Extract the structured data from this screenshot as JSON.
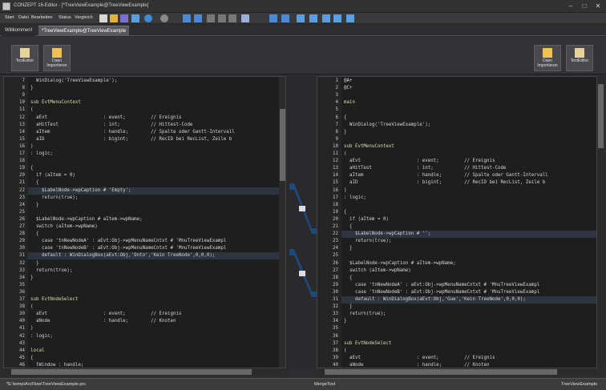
{
  "window": {
    "title": "CONZEPT 16-Editor - [*TreeViewExample@TreeViewExample]"
  },
  "menu": [
    "Start",
    "Datei",
    "Bearbeiten",
    "Status",
    "Vergleich"
  ],
  "tabs": [
    {
      "label": "Willkommen!",
      "active": false
    },
    {
      "label": "*TreeViewExample@TreeViewExample",
      "active": true
    }
  ],
  "ribbon": {
    "left": [
      {
        "label": "TextEditor",
        "icon": "text-editor-icon"
      },
      {
        "label": "Datei Importieren",
        "icon": "folder-import-icon"
      }
    ],
    "right": [
      {
        "label": "Datei Importieren",
        "icon": "folder-import-icon"
      },
      {
        "label": "TextEditor",
        "icon": "text-editor-icon"
      }
    ]
  },
  "left_pane": {
    "lines": [
      {
        "n": "7",
        "t": "  WinDialog('TreeViewExample');"
      },
      {
        "n": "8",
        "t": "}"
      },
      {
        "n": "9",
        "t": ""
      },
      {
        "n": "10",
        "t": "sub EvtMenuContext"
      },
      {
        "n": "11",
        "t": "("
      },
      {
        "n": "12",
        "t": "  aEvt                    : event;         // Ereignis"
      },
      {
        "n": "13",
        "t": "  aHitTest                : int;           // Hittest-Code"
      },
      {
        "n": "14",
        "t": "  aItem                   : handle;        // Spalte oder Gantt-Intervall"
      },
      {
        "n": "15",
        "t": "  aID                     : bigint;        // RecID bei RecList, Zeile b"
      },
      {
        "n": "16",
        "t": ")"
      },
      {
        "n": "17",
        "t": ": logic;"
      },
      {
        "n": "18",
        "t": ""
      },
      {
        "n": "19",
        "t": "{"
      },
      {
        "n": "20",
        "t": "  if (aItem = 0)"
      },
      {
        "n": "21",
        "t": "  {"
      },
      {
        "n": "22",
        "t": "    $LabelNode->wpCaption # 'Empty';"
      },
      {
        "n": "23",
        "t": "    return(true);"
      },
      {
        "n": "24",
        "t": "  }"
      },
      {
        "n": "25",
        "t": ""
      },
      {
        "n": "26",
        "t": "  $LabelNode->wpCaption # aItem->wpName;"
      },
      {
        "n": "27",
        "t": "  switch (aItem->wpName)"
      },
      {
        "n": "28",
        "t": "  {"
      },
      {
        "n": "29",
        "t": "    case 'tnNewNodeA' : aEvt:Obj->wpMenuNameCntxt # 'MnuTreeViewExampl"
      },
      {
        "n": "30",
        "t": "    case 'tnNewNodeB' : aEvt:Obj->wpMenuNameCntxt # 'MnuTreeViewExampl"
      },
      {
        "n": "31",
        "t": "    default : WinDialogBox(aEvt:Obj,'Onto','Kein TreeNode',0,0,0);"
      },
      {
        "n": "32",
        "t": "  }"
      },
      {
        "n": "33",
        "t": "  return(true);"
      },
      {
        "n": "34",
        "t": "}"
      },
      {
        "n": "35",
        "t": ""
      },
      {
        "n": "36",
        "t": ""
      },
      {
        "n": "37",
        "t": "sub EvtNodeSelect"
      },
      {
        "n": "38",
        "t": "("
      },
      {
        "n": "39",
        "t": "  aEvt                    : event;         // Ereignis"
      },
      {
        "n": "40",
        "t": "  aNode                   : handle;        // Knoten"
      },
      {
        "n": "41",
        "t": ")"
      },
      {
        "n": "42",
        "t": ": logic;"
      },
      {
        "n": "43",
        "t": ""
      },
      {
        "n": "44",
        "t": "local"
      },
      {
        "n": "45",
        "t": "{"
      },
      {
        "n": "46",
        "t": "  tWindow : handle;"
      }
    ]
  },
  "right_pane": {
    "lines": [
      {
        "n": "1",
        "t": "@A+"
      },
      {
        "n": "2",
        "t": "@C+"
      },
      {
        "n": "3",
        "t": ""
      },
      {
        "n": "4",
        "t": "main"
      },
      {
        "n": "5",
        "t": ""
      },
      {
        "n": "6",
        "t": "{"
      },
      {
        "n": "7",
        "t": "  WinDialog('TreeViewExample');"
      },
      {
        "n": "8",
        "t": "}"
      },
      {
        "n": "9",
        "t": ""
      },
      {
        "n": "10",
        "t": "sub EvtMenuContext"
      },
      {
        "n": "11",
        "t": "("
      },
      {
        "n": "12",
        "t": "  aEvt                    : event;         // Ereignis"
      },
      {
        "n": "13",
        "t": "  aHitTest                : int;           // Hittest-Code"
      },
      {
        "n": "14",
        "t": "  aItem                   : handle;        // Spalte oder Gantt-Intervall"
      },
      {
        "n": "15",
        "t": "  aID                     : bigint;        // RecID bei RecList, Zeile b"
      },
      {
        "n": "16",
        "t": ")"
      },
      {
        "n": "17",
        "t": ": logic;"
      },
      {
        "n": "18",
        "t": ""
      },
      {
        "n": "19",
        "t": "{"
      },
      {
        "n": "20",
        "t": "  if (aItem = 0)"
      },
      {
        "n": "21",
        "t": "  {"
      },
      {
        "n": "22",
        "t": "    $LabelNode->wpCaption # '';"
      },
      {
        "n": "23",
        "t": "    return(true);"
      },
      {
        "n": "24",
        "t": "  }"
      },
      {
        "n": "25",
        "t": ""
      },
      {
        "n": "26",
        "t": "  $LabelNode->wpCaption # aItem->wpName;"
      },
      {
        "n": "27",
        "t": "  switch (aItem->wpName)"
      },
      {
        "n": "28",
        "t": "  {"
      },
      {
        "n": "29",
        "t": "    case 'tnNewNodeA' : aEvt:Obj->wpMenuNameCntxt # 'MnuTreeViewExampl"
      },
      {
        "n": "30",
        "t": "    case 'tnNewNodeB' : aEvt:Obj->wpMenuNameCntxt # 'MnuTreeViewExampl"
      },
      {
        "n": "31",
        "t": "    default : WinDialogBox(aEvt:Obj,'Gue','Kein TreeNode',0,0,0);"
      },
      {
        "n": "32",
        "t": "  }"
      },
      {
        "n": "33",
        "t": "  return(true);"
      },
      {
        "n": "34",
        "t": "}"
      },
      {
        "n": "35",
        "t": ""
      },
      {
        "n": "36",
        "t": ""
      },
      {
        "n": "37",
        "t": "sub EvtNodeSelect"
      },
      {
        "n": "38",
        "t": "("
      },
      {
        "n": "39",
        "t": "  aEvt                    : event;         // Ereignis"
      },
      {
        "n": "40",
        "t": "  aNode                   : handle;        // Knoten"
      }
    ]
  },
  "status": {
    "left": "*E:\\temp\\ArcFlow\\TreeViewExample.prc",
    "center": "MergeTool",
    "right": "TreeViewExample"
  },
  "colors": {
    "keyword": "#d4d4d4",
    "type": "#569cd6",
    "string": "#ce9178",
    "comment": "#9cdcfe",
    "changed": "#3c7a3c",
    "accent": "#1e4f8a"
  }
}
